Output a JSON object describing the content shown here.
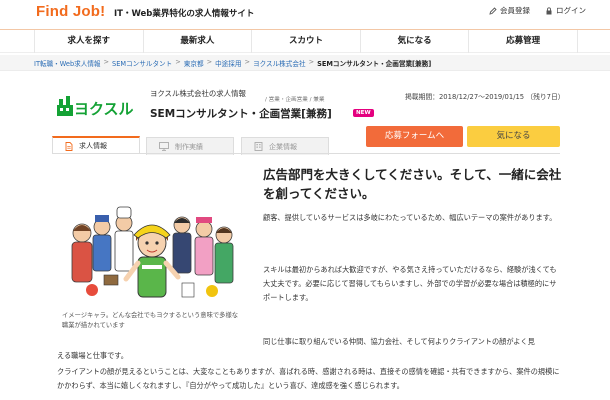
{
  "header": {
    "logo": "Find Job!",
    "tagline": "IT・Web業界特化の求人情報サイト",
    "register_label": "会員登録",
    "login_label": "ログイン"
  },
  "nav": {
    "items": [
      {
        "label": "求人を探す"
      },
      {
        "label": "最新求人"
      },
      {
        "label": "スカウト"
      },
      {
        "label": "気になる"
      },
      {
        "label": "応募管理"
      }
    ]
  },
  "breadcrumb": {
    "items": [
      "IT転職・Web求人情報",
      "SEMコンサルタント",
      "東京都",
      "中途採用",
      "ヨクスル株式会社"
    ],
    "current": "SEMコンサルタント・企画営業[兼務]"
  },
  "company": {
    "logo_text": "ヨクスル",
    "name_line": "ヨクスル株式会社の求人情報",
    "tags": "/ 営業・企画営業 / 兼業",
    "job_title": "SEMコンサルタント・企画営業[兼務]",
    "new_badge": "NEW",
    "period": "掲載期間：2018/12/27～2019/01/15 （残り7日）"
  },
  "actions": {
    "apply_label": "応募フォームへ",
    "favorite_label": "気になる"
  },
  "tabs": [
    {
      "label": "求人情報",
      "active": true
    },
    {
      "label": "制作実績",
      "active": false
    },
    {
      "label": "企業情報",
      "active": false
    }
  ],
  "content": {
    "headline": "広告部門を大きくしてください。そして、一緒に会社を創ってください。",
    "p1": "顧客、提供しているサービスは多岐にわたっているため、幅広いテーマの案件があります。",
    "p2": "スキルは最初からあれば大歓迎ですが、やる気さえ持っていただけるなら、経験が浅くても大丈夫です。必要に応じて習得してもらいますし、外部での学習が必要な場合は積極的にサポートします。",
    "p3a": "同じ仕事に取り組んでいる仲間、協力会社、そして何よりクライアントの顔がよく見",
    "p3b": "える職場と仕事です。",
    "p4": "クライアントの顔が見えるということは、大変なこともありますが、喜ばれる時、感謝される時は、直接その感情を確認・共有できますから、案件の規模にかかわらず、本当に嬉しくなれますし、『自分がやって成功した』という喜び、達成感を強く感じられます。",
    "caption": "イメージキャラ。どんな会社でもヨクするという意味で多様な職業が描かれています"
  },
  "colors": {
    "brand": "#f26b1d",
    "apply": "#f26b3a",
    "favorite": "#fbcd40",
    "new_badge": "#e4007f",
    "link": "#2a6cb5"
  }
}
